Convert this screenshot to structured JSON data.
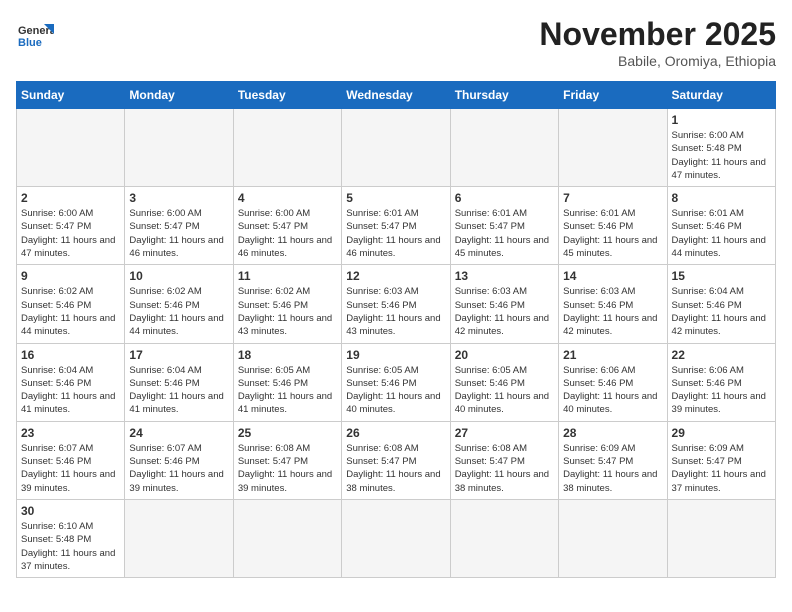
{
  "header": {
    "logo_general": "General",
    "logo_blue": "Blue",
    "month_title": "November 2025",
    "location": "Babile, Oromiya, Ethiopia"
  },
  "weekdays": [
    "Sunday",
    "Monday",
    "Tuesday",
    "Wednesday",
    "Thursday",
    "Friday",
    "Saturday"
  ],
  "days": [
    {
      "num": "",
      "empty": true
    },
    {
      "num": "",
      "empty": true
    },
    {
      "num": "",
      "empty": true
    },
    {
      "num": "",
      "empty": true
    },
    {
      "num": "",
      "empty": true
    },
    {
      "num": "",
      "empty": true
    },
    {
      "num": "1",
      "sunrise": "6:00 AM",
      "sunset": "5:48 PM",
      "daylight": "11 hours and 47 minutes."
    },
    {
      "num": "2",
      "sunrise": "6:00 AM",
      "sunset": "5:47 PM",
      "daylight": "11 hours and 47 minutes."
    },
    {
      "num": "3",
      "sunrise": "6:00 AM",
      "sunset": "5:47 PM",
      "daylight": "11 hours and 46 minutes."
    },
    {
      "num": "4",
      "sunrise": "6:00 AM",
      "sunset": "5:47 PM",
      "daylight": "11 hours and 46 minutes."
    },
    {
      "num": "5",
      "sunrise": "6:01 AM",
      "sunset": "5:47 PM",
      "daylight": "11 hours and 46 minutes."
    },
    {
      "num": "6",
      "sunrise": "6:01 AM",
      "sunset": "5:47 PM",
      "daylight": "11 hours and 45 minutes."
    },
    {
      "num": "7",
      "sunrise": "6:01 AM",
      "sunset": "5:46 PM",
      "daylight": "11 hours and 45 minutes."
    },
    {
      "num": "8",
      "sunrise": "6:01 AM",
      "sunset": "5:46 PM",
      "daylight": "11 hours and 44 minutes."
    },
    {
      "num": "9",
      "sunrise": "6:02 AM",
      "sunset": "5:46 PM",
      "daylight": "11 hours and 44 minutes."
    },
    {
      "num": "10",
      "sunrise": "6:02 AM",
      "sunset": "5:46 PM",
      "daylight": "11 hours and 44 minutes."
    },
    {
      "num": "11",
      "sunrise": "6:02 AM",
      "sunset": "5:46 PM",
      "daylight": "11 hours and 43 minutes."
    },
    {
      "num": "12",
      "sunrise": "6:03 AM",
      "sunset": "5:46 PM",
      "daylight": "11 hours and 43 minutes."
    },
    {
      "num": "13",
      "sunrise": "6:03 AM",
      "sunset": "5:46 PM",
      "daylight": "11 hours and 42 minutes."
    },
    {
      "num": "14",
      "sunrise": "6:03 AM",
      "sunset": "5:46 PM",
      "daylight": "11 hours and 42 minutes."
    },
    {
      "num": "15",
      "sunrise": "6:04 AM",
      "sunset": "5:46 PM",
      "daylight": "11 hours and 42 minutes."
    },
    {
      "num": "16",
      "sunrise": "6:04 AM",
      "sunset": "5:46 PM",
      "daylight": "11 hours and 41 minutes."
    },
    {
      "num": "17",
      "sunrise": "6:04 AM",
      "sunset": "5:46 PM",
      "daylight": "11 hours and 41 minutes."
    },
    {
      "num": "18",
      "sunrise": "6:05 AM",
      "sunset": "5:46 PM",
      "daylight": "11 hours and 41 minutes."
    },
    {
      "num": "19",
      "sunrise": "6:05 AM",
      "sunset": "5:46 PM",
      "daylight": "11 hours and 40 minutes."
    },
    {
      "num": "20",
      "sunrise": "6:05 AM",
      "sunset": "5:46 PM",
      "daylight": "11 hours and 40 minutes."
    },
    {
      "num": "21",
      "sunrise": "6:06 AM",
      "sunset": "5:46 PM",
      "daylight": "11 hours and 40 minutes."
    },
    {
      "num": "22",
      "sunrise": "6:06 AM",
      "sunset": "5:46 PM",
      "daylight": "11 hours and 39 minutes."
    },
    {
      "num": "23",
      "sunrise": "6:07 AM",
      "sunset": "5:46 PM",
      "daylight": "11 hours and 39 minutes."
    },
    {
      "num": "24",
      "sunrise": "6:07 AM",
      "sunset": "5:46 PM",
      "daylight": "11 hours and 39 minutes."
    },
    {
      "num": "25",
      "sunrise": "6:08 AM",
      "sunset": "5:47 PM",
      "daylight": "11 hours and 39 minutes."
    },
    {
      "num": "26",
      "sunrise": "6:08 AM",
      "sunset": "5:47 PM",
      "daylight": "11 hours and 38 minutes."
    },
    {
      "num": "27",
      "sunrise": "6:08 AM",
      "sunset": "5:47 PM",
      "daylight": "11 hours and 38 minutes."
    },
    {
      "num": "28",
      "sunrise": "6:09 AM",
      "sunset": "5:47 PM",
      "daylight": "11 hours and 38 minutes."
    },
    {
      "num": "29",
      "sunrise": "6:09 AM",
      "sunset": "5:47 PM",
      "daylight": "11 hours and 37 minutes."
    },
    {
      "num": "30",
      "sunrise": "6:10 AM",
      "sunset": "5:48 PM",
      "daylight": "11 hours and 37 minutes."
    },
    {
      "num": "",
      "empty": true
    },
    {
      "num": "",
      "empty": true
    },
    {
      "num": "",
      "empty": true
    },
    {
      "num": "",
      "empty": true
    },
    {
      "num": "",
      "empty": true
    },
    {
      "num": "",
      "empty": true
    }
  ]
}
